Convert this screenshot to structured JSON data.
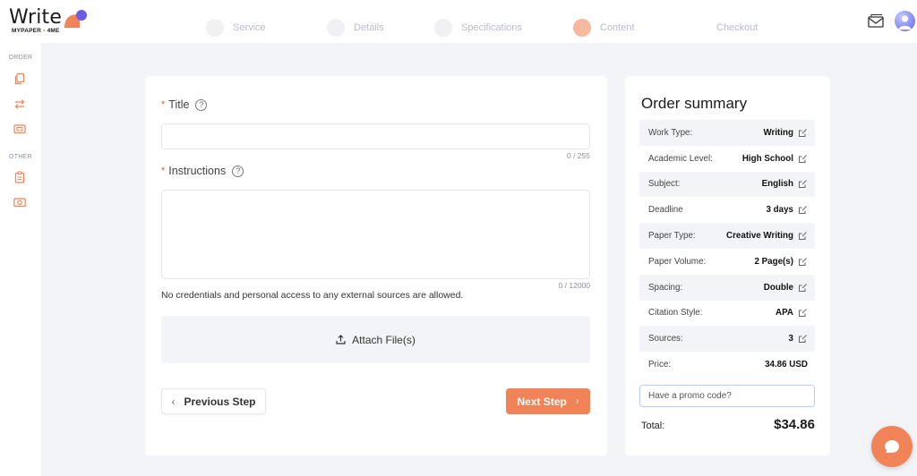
{
  "brand": {
    "word": "Write",
    "sub_a": "MYPAPER",
    "sub_b": "4ME",
    "accent": "#f08358"
  },
  "header": {
    "steps": [
      {
        "label": "Service",
        "active": false
      },
      {
        "label": "Details",
        "active": false
      },
      {
        "label": "Specifications",
        "active": false
      },
      {
        "label": "Content",
        "active": true
      },
      {
        "label": "Checkout",
        "active": false
      }
    ]
  },
  "sidebar": {
    "sections": [
      {
        "label": "ORDER",
        "icons": [
          "copy-icon",
          "swap-icon",
          "card-icon"
        ]
      },
      {
        "label": "OTHER",
        "icons": [
          "clipboard-icon",
          "money-icon"
        ]
      }
    ]
  },
  "form": {
    "title_label": "Title",
    "title_value": "",
    "title_counter": "0 / 255",
    "instructions_label": "Instructions",
    "instructions_value": "",
    "instructions_counter": "0 / 12000",
    "note": "No credentials and personal access to any external sources are allowed.",
    "attach_label": "Attach File(s)",
    "prev_label": "Previous Step",
    "next_label": "Next Step"
  },
  "summary": {
    "title": "Order summary",
    "rows": [
      {
        "key": "Work Type:",
        "value": "Writing",
        "editable": true
      },
      {
        "key": "Academic Level:",
        "value": "High School",
        "editable": true
      },
      {
        "key": "Subject:",
        "value": "English",
        "editable": true
      },
      {
        "key": "Deadline",
        "value": "3 days",
        "editable": true
      },
      {
        "key": "Paper Type:",
        "value": "Creative Writing",
        "editable": true
      },
      {
        "key": "Paper Volume:",
        "value": "2 Page(s)",
        "editable": true
      },
      {
        "key": "Spacing:",
        "value": "Double",
        "editable": true
      },
      {
        "key": "Citation Style:",
        "value": "APA",
        "editable": true
      },
      {
        "key": "Sources:",
        "value": "3",
        "editable": true
      },
      {
        "key": "Price:",
        "value": "34.86 USD",
        "editable": false
      }
    ],
    "promo_placeholder": "Have a promo code?",
    "total_label": "Total:",
    "total_value": "$34.86"
  }
}
